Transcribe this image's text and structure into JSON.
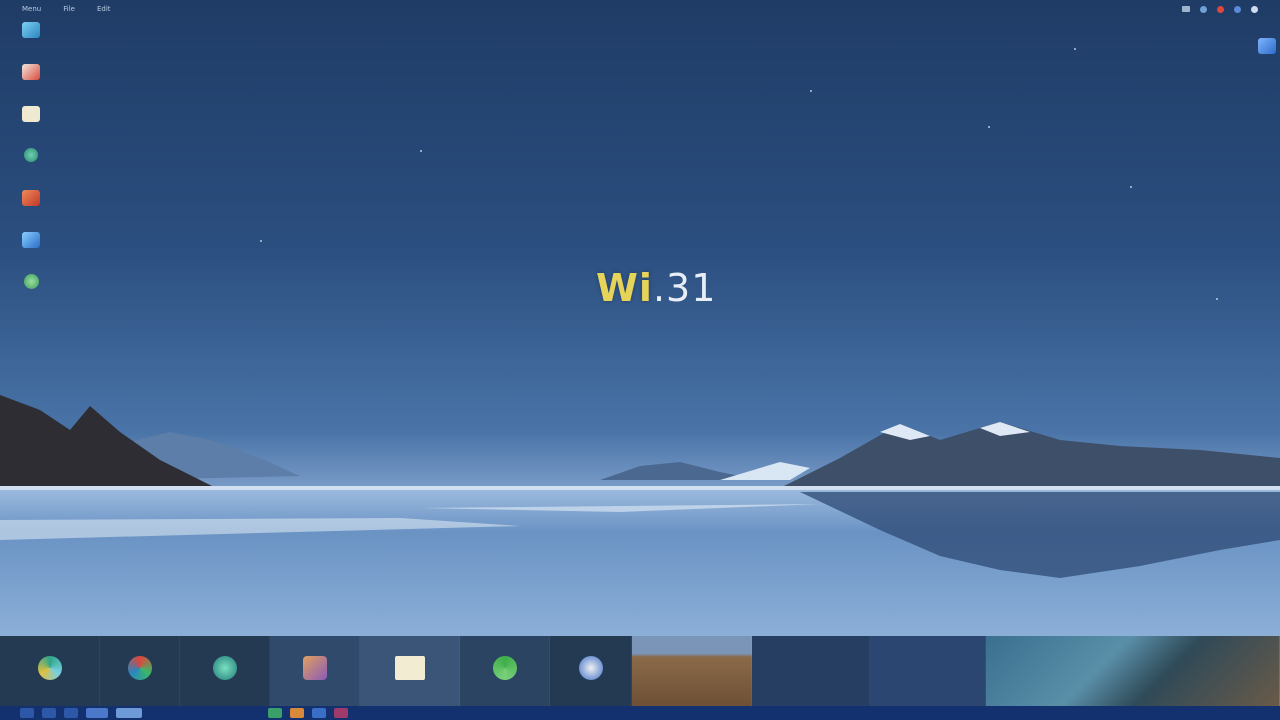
{
  "logo": {
    "prefix": "Wi",
    "suffix": ".31"
  },
  "topbar": {
    "items": [
      "Menu",
      "File",
      "Edit"
    ]
  },
  "desktop_icons": [
    {
      "name": "monitor-icon",
      "label": "",
      "color": "#3aa0d8"
    },
    {
      "name": "mail-icon",
      "label": "",
      "color": "#d84a3a"
    },
    {
      "name": "notepad-icon",
      "label": "",
      "color": "#e8e2c8"
    },
    {
      "name": "browser-icon",
      "label": "",
      "color": "#3aa88a"
    },
    {
      "name": "office-icon",
      "label": "",
      "color": "#d0533a"
    },
    {
      "name": "cloud-icon",
      "label": "",
      "color": "#3a8ed8"
    },
    {
      "name": "store-icon",
      "label": "",
      "color": "#5ab86a"
    }
  ],
  "preview_tiles": [
    {
      "name": "app-copilot",
      "label": "",
      "color": "#2ea58a"
    },
    {
      "name": "app-photos",
      "label": "",
      "color": "#e0463a"
    },
    {
      "name": "app-edge",
      "label": "",
      "color": "#2ba7a2"
    },
    {
      "name": "app-files",
      "label": "",
      "color": "#d88a3a"
    },
    {
      "name": "app-notepad",
      "label": "",
      "color": "#f2ecd2"
    },
    {
      "name": "app-recycle",
      "label": "",
      "color": "#3fae4a"
    },
    {
      "name": "app-globe",
      "label": "",
      "color": "#3a6fc8"
    }
  ],
  "colors": {
    "accent": "#e6d35a",
    "taskbar": "#13316e",
    "strip": "#243a52"
  }
}
